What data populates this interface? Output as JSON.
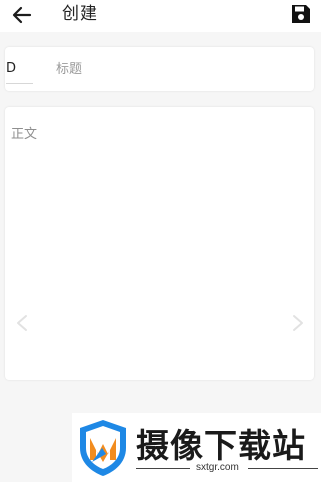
{
  "header": {
    "title": "创建",
    "back_icon": "arrow-left-icon",
    "save_icon": "save-floppy-icon"
  },
  "title_field": {
    "prefix": "D",
    "placeholder": "标题"
  },
  "body_field": {
    "placeholder": "正文"
  },
  "nav": {
    "prev_icon": "chevron-left-icon",
    "next_icon": "chevron-right-icon"
  },
  "watermark": {
    "name": "摄像下载站",
    "domain": "sxtgr.com",
    "logo_icon": "shield-m-logo"
  },
  "colors": {
    "background": "#f6f6f6",
    "card": "#ffffff",
    "placeholder": "#9a9a9a",
    "logo_blue": "#1e88e5",
    "logo_orange": "#f28c1e"
  }
}
